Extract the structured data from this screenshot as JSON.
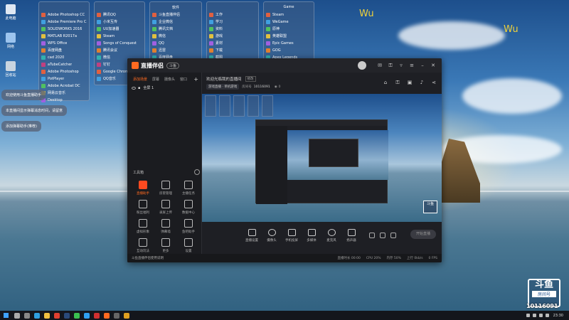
{
  "desktop": {
    "icons": [
      {
        "label": "此电脑",
        "icon": "computer-icon"
      },
      {
        "label": "网络",
        "icon": "network-icon"
      },
      {
        "label": "回收站",
        "icon": "recycle-bin-icon"
      }
    ],
    "folders": [
      {
        "title": "",
        "items": [
          "Adobe Photoshop CC",
          "Adobe Premiere Pro C...",
          "SOLIDWORKS 2016",
          "MATLAB R2017a",
          "WPS Office",
          "百度网盘",
          "cad 2020",
          "aTubeCatcher",
          "Adobe Photoshop",
          "PotPlayer",
          "Adobe Acrobat DC",
          "网易云音乐",
          "Desktop"
        ]
      },
      {
        "title": "",
        "items": [
          "腾讯QQ",
          "小米互传",
          "UU加速器",
          "Steam",
          "Songs of Conquest",
          "腾讯会议",
          "微信",
          "钉钉",
          "Google Chrome",
          "QQ音乐"
        ]
      },
      {
        "title": "软件",
        "items": [
          "斗鱼直播伴侣",
          "企业微信",
          "腾讯文档",
          "微信",
          "QQ",
          "迅雷",
          "百度网盘",
          "爱奇艺"
        ]
      },
      {
        "title": "",
        "items": [
          "工作",
          "学习",
          "资料",
          "游戏",
          "素材",
          "下载",
          "截图",
          "文档"
        ]
      },
      {
        "title": "Game",
        "items": [
          "Steam",
          "WeGame",
          "原神",
          "英雄联盟",
          "Epic Games",
          "GOG",
          "Apex Legends",
          "战网"
        ]
      }
    ],
    "wu_text": "Wu"
  },
  "notifications": [
    {
      "text": "欢迎使用斗鱼直播助手"
    },
    {
      "text": "本直播间显示弹幕消息时间，请留意"
    },
    {
      "text": "添加弹幕助手(推荐)"
    }
  ],
  "app": {
    "name": "直播伴侣",
    "version": "斗鱼",
    "left_tabs": [
      "添加场景",
      "屏幕",
      "摄像头",
      "窗口"
    ],
    "scene_name": "全屏 1",
    "tools_title": "工具箱",
    "tools": [
      {
        "label": "直播助手",
        "hot": true
      },
      {
        "label": "房管管理",
        "hot": false
      },
      {
        "label": "主播任务",
        "hot": false
      },
      {
        "label": "粉丝福利",
        "hot": false
      },
      {
        "label": "录屏上传",
        "hot": false
      },
      {
        "label": "数据中心",
        "hot": false
      },
      {
        "label": "虚拟形象",
        "hot": false
      },
      {
        "label": "弹幕墙",
        "hot": false
      },
      {
        "label": "鱼吧助手",
        "hot": false
      },
      {
        "label": "互动玩法",
        "hot": false
      },
      {
        "label": "更多",
        "hot": false
      },
      {
        "label": "设置",
        "hot": false
      }
    ],
    "left_status": "斗鱼直播伴侣使用说明",
    "room": {
      "title": "欢迎光临我的直播间",
      "edit_label": "修改",
      "category": "游戏直播 · 单机游戏",
      "room_label": "房间号",
      "room_no": "10116091",
      "viewers": "0"
    },
    "controls": [
      {
        "label": "直播设置",
        "icon": "screen-icon"
      },
      {
        "label": "摄像头",
        "icon": "camera-icon"
      },
      {
        "label": "手机投屏",
        "icon": "phone-cast-icon"
      },
      {
        "label": "多媒体",
        "icon": "media-icon"
      },
      {
        "label": "麦克风",
        "icon": "mic-icon"
      },
      {
        "label": "扬声器",
        "icon": "speaker-icon"
      }
    ],
    "start_button": "开始直播",
    "status_items": [
      "直播时长 00:00",
      "CPU 20%",
      "内存 50%",
      "上行 0kb/s",
      "0 FPS"
    ]
  },
  "watermark": {
    "logo": "斗鱼",
    "sub": "房间号",
    "room_no": "10116091"
  },
  "taskbar": {
    "clock": "23:30"
  },
  "colors": {
    "accent": "#ff6a20",
    "app_bg": "#1e1f24",
    "wu": "#f1d23a"
  }
}
